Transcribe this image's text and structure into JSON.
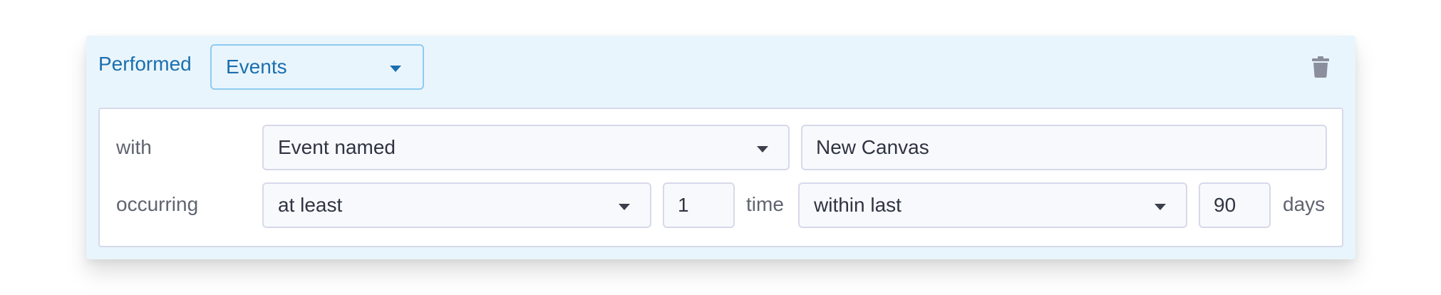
{
  "filter": {
    "performed_label": "Performed",
    "type_select": {
      "value": "Events"
    },
    "delete_icon": "trash-icon",
    "rows": {
      "with": {
        "label": "with",
        "condition_select": {
          "value": "Event named"
        },
        "event_name_input": {
          "value": "New Canvas"
        }
      },
      "occurring": {
        "label": "occurring",
        "frequency_select": {
          "value": "at least"
        },
        "count_input": {
          "value": "1"
        },
        "count_unit": "time",
        "window_select": {
          "value": "within last"
        },
        "days_input": {
          "value": "90"
        },
        "days_unit": "days"
      }
    }
  },
  "colors": {
    "accent": "#1b6fae",
    "card_background": "#e9f5fc",
    "border": "#d7d9ea",
    "icon": "#8b8e9d"
  }
}
